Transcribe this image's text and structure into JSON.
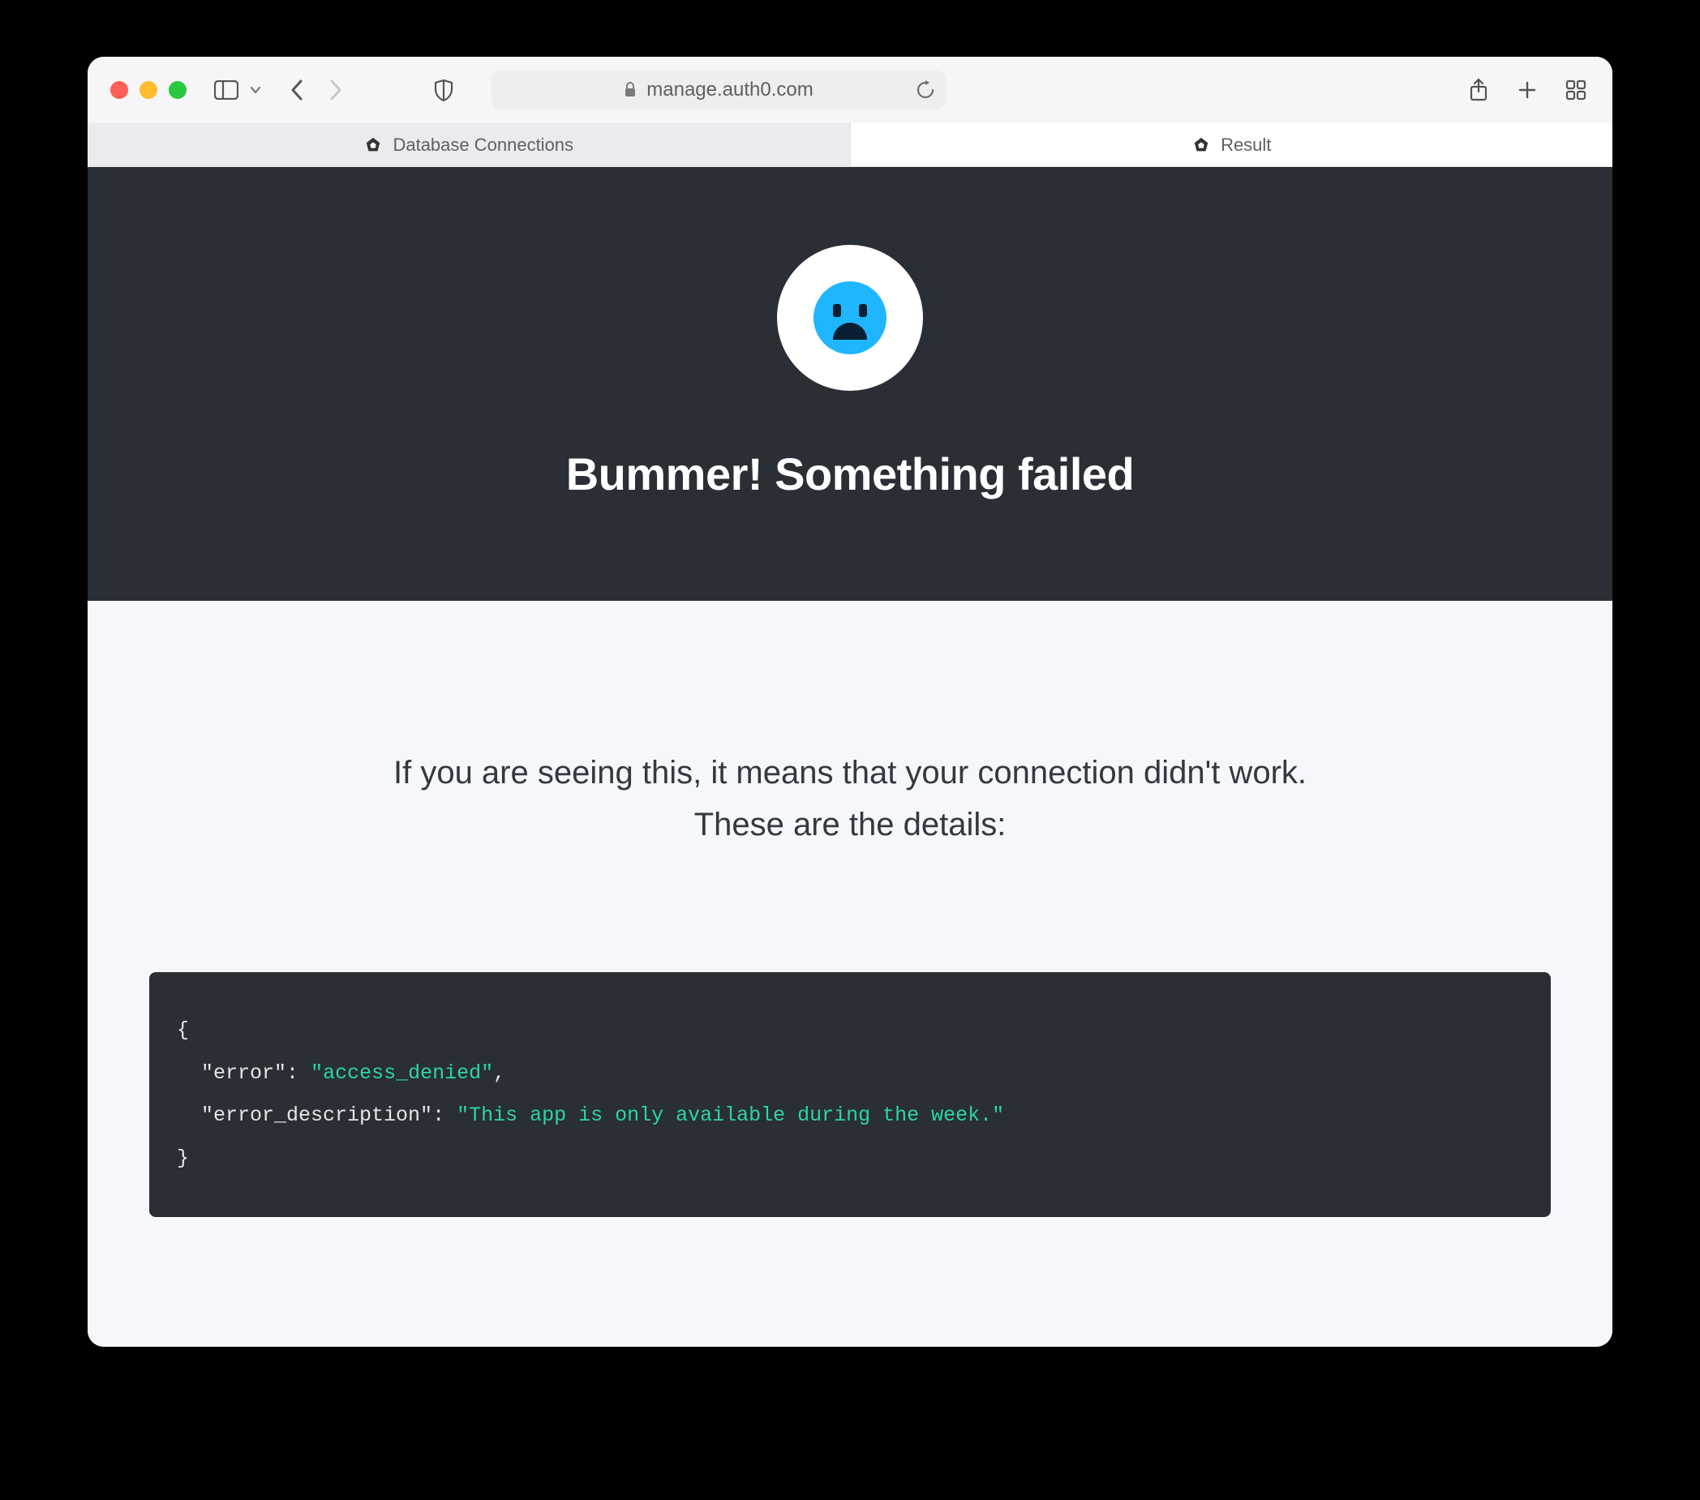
{
  "browser": {
    "address": "manage.auth0.com",
    "tabs": [
      {
        "label": "Database Connections",
        "active": false
      },
      {
        "label": "Result",
        "active": true
      }
    ]
  },
  "hero": {
    "title": "Bummer! Something failed"
  },
  "details": {
    "line1": "If you are seeing this, it means that your connection didn't work.",
    "line2": "These are the details:"
  },
  "error": {
    "key1": "\"error\"",
    "val1": "\"access_denied\"",
    "key2": "\"error_description\"",
    "val2": "\"This app is only available during the week.\""
  }
}
